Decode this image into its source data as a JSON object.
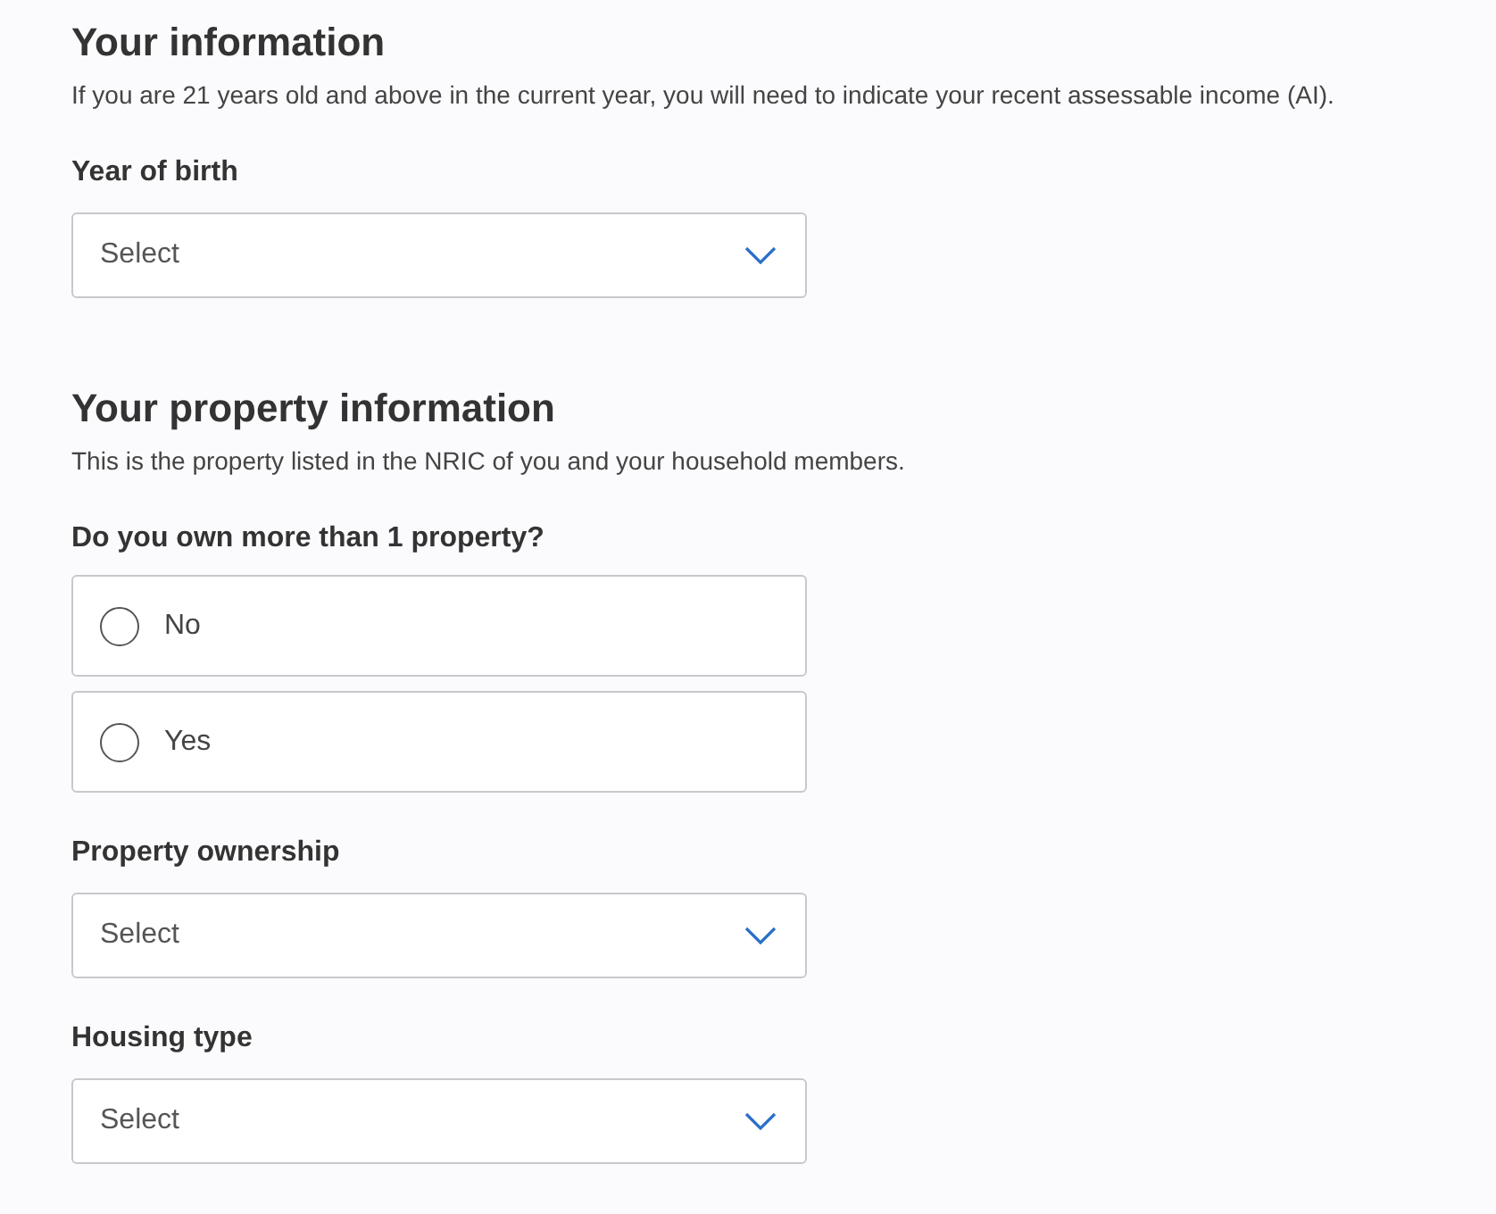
{
  "sections": [
    {
      "title": "Your information",
      "description": "If you are 21 years old and above in the current year, you will need to indicate your recent assessable income (AI).",
      "fields": [
        {
          "kind": "select",
          "label": "Year of birth",
          "placeholder": "Select"
        }
      ]
    },
    {
      "title": "Your property information",
      "description": "This is the property listed in the NRIC of you and your household members.",
      "fields": [
        {
          "kind": "radio",
          "label": "Do you own more than 1 property?",
          "options": [
            {
              "label": "No",
              "selected": false
            },
            {
              "label": "Yes",
              "selected": false
            }
          ]
        },
        {
          "kind": "select",
          "label": "Property ownership",
          "placeholder": "Select"
        },
        {
          "kind": "select",
          "label": "Housing type",
          "placeholder": "Select"
        }
      ]
    }
  ]
}
